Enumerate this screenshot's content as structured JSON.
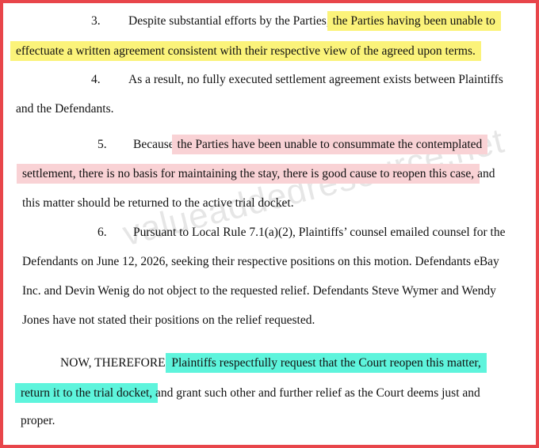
{
  "colors": {
    "border": "#e8454a",
    "highlight_yellow": "#fbf37a",
    "highlight_pink": "#f9d2d5",
    "highlight_cyan": "#5ef4dc"
  },
  "watermark": "valueaddedresource.net",
  "para3": {
    "number": "3.",
    "line1_plain": "Despite substantial efforts by the Parties,",
    "line1_hl": "the Parties having been unable to",
    "line2_hl": "effectuate a written agreement consistent with their respective view of the agreed upon terms."
  },
  "para4": {
    "number": "4.",
    "line1": "As a result, no fully executed settlement agreement exists between Plaintiffs",
    "line2": "and the Defendants."
  },
  "para5": {
    "number": "5.",
    "line1_plain": "Because",
    "line1_hl": "the Parties have been unable to consummate the contemplated",
    "line2_hl": "settlement, there is no basis for maintaining the stay, there is good cause to reopen this case,",
    "line2_plain": "and",
    "line3": "this matter should be returned to the active trial docket."
  },
  "para6": {
    "number": "6.",
    "line1": "Pursuant to Local Rule 7.1(a)(2), Plaintiffs’ counsel emailed counsel for the",
    "line2": "Defendants on June 12, 2026, seeking their respective positions on this motion. Defendants eBay",
    "line3": "Inc. and Devin Wenig do not object to the requested relief. Defendants Steve Wymer and Wendy",
    "line4": "Jones have not stated their positions on the relief requested."
  },
  "conclusion": {
    "line1_plain": "NOW, THEREFORE,",
    "line1_hl": "Plaintiffs respectfully request that the Court reopen this matter,",
    "line2_hl": "return it to the trial docket,",
    "line2_plain": "and grant such other and further relief as the Court deems just and",
    "line3": "proper."
  }
}
